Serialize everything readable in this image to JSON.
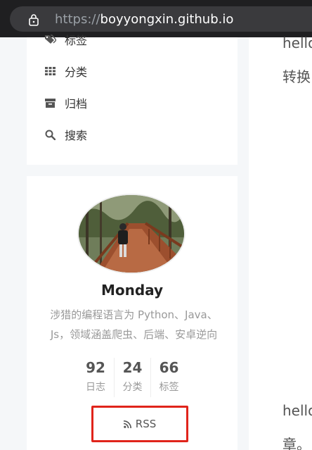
{
  "browser": {
    "url_protocol": "https://",
    "url_host": "boyyongxin.github.io"
  },
  "menu": {
    "items": [
      {
        "label": "标签",
        "icon": "tags-icon"
      },
      {
        "label": "分类",
        "icon": "th-icon"
      },
      {
        "label": "归档",
        "icon": "archive-icon"
      },
      {
        "label": "搜索",
        "icon": "search-icon"
      }
    ]
  },
  "profile": {
    "name": "Monday",
    "description": "涉猎的编程语言为 Python、Java、Js，领域涵盖爬虫、后端、安卓逆向",
    "stats": [
      {
        "count": "92",
        "label": "日志"
      },
      {
        "count": "24",
        "label": "分类"
      },
      {
        "count": "66",
        "label": "标签"
      }
    ],
    "rss_label": "RSS"
  },
  "posts": {
    "line1": "hello",
    "line2": "转换",
    "line3": "hello",
    "line4": "章。"
  }
}
